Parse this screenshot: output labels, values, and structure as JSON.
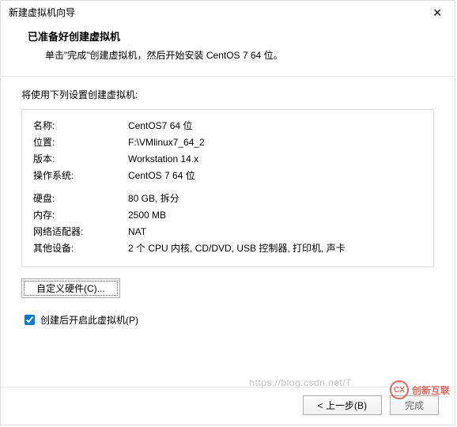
{
  "window": {
    "title": "新建虚拟机向导",
    "close_icon_label": "✕"
  },
  "header": {
    "headline": "已准备好创建虚拟机",
    "sub": "单击\"完成\"创建虚拟机，然后开始安装 CentOS 7 64 位。"
  },
  "intro": "将使用下列设置创建虚拟机:",
  "settings": [
    {
      "label": "名称:",
      "value": "CentOS7 64 位"
    },
    {
      "label": "位置:",
      "value": "F:\\VMlinux7_64_2"
    },
    {
      "label": "版本:",
      "value": "Workstation 14.x"
    },
    {
      "label": "操作系统:",
      "value": "CentOS 7 64 位"
    }
  ],
  "settings2": [
    {
      "label": "硬盘:",
      "value": "80 GB, 拆分"
    },
    {
      "label": "内存:",
      "value": "2500 MB"
    },
    {
      "label": "网络适配器:",
      "value": "NAT"
    },
    {
      "label": "其他设备:",
      "value": "2 个 CPU 内核, CD/DVD, USB 控制器, 打印机, 声卡"
    }
  ],
  "customize_button": "自定义硬件(C)...",
  "checkbox_label": "创建后开启此虚拟机(P)",
  "checkbox_checked": true,
  "buttons": {
    "back": "< 上一步(B)",
    "finish": "完成"
  },
  "watermark": {
    "brand": "创新互联"
  },
  "wm_url": "https://blog.csdn.net/T"
}
